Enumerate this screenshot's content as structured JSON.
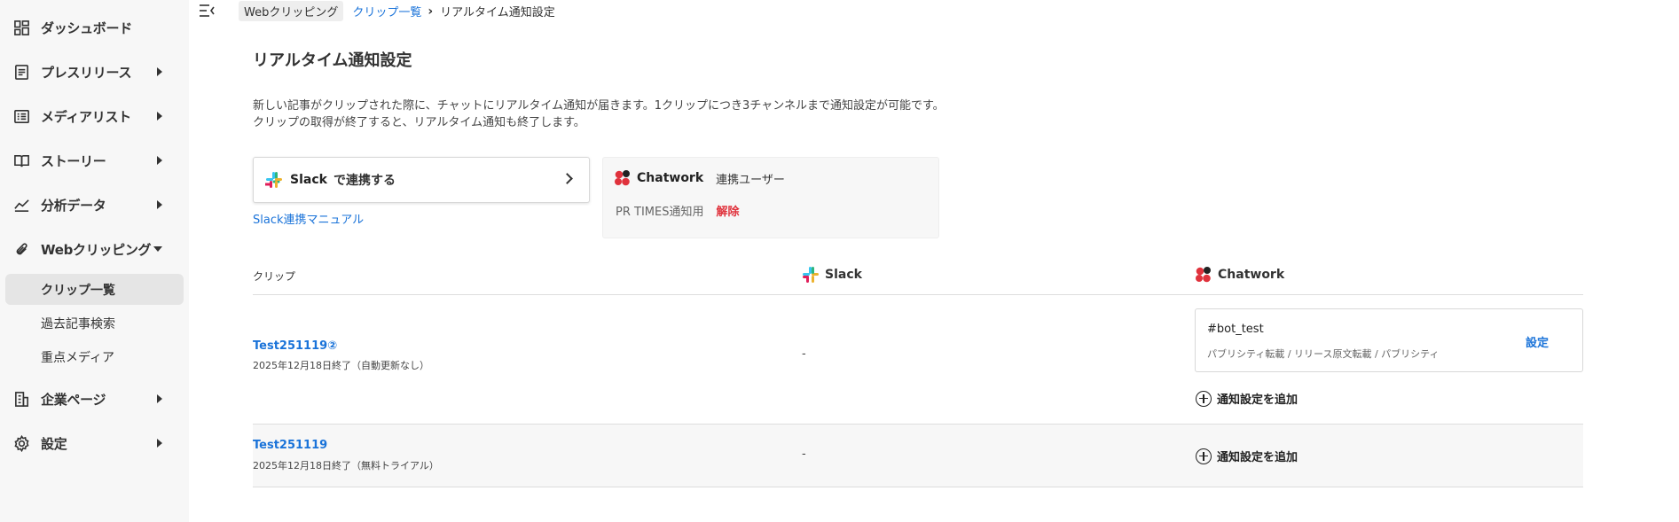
{
  "colors": {
    "accent": "#1a73d9",
    "danger": "#e0323c",
    "sidebar_bg": "#f7f7f7"
  },
  "sidebar": {
    "items": [
      {
        "label": "ダッシュボード",
        "icon": "dashboard-icon"
      },
      {
        "label": "プレスリリース",
        "icon": "document-icon"
      },
      {
        "label": "メディアリスト",
        "icon": "list-icon"
      },
      {
        "label": "ストーリー",
        "icon": "book-icon"
      },
      {
        "label": "分析データ",
        "icon": "chart-icon"
      },
      {
        "label": "Webクリッピング",
        "icon": "paperclip-icon"
      },
      {
        "label": "企業ページ",
        "icon": "building-icon"
      },
      {
        "label": "設定",
        "icon": "gear-icon"
      }
    ],
    "sub_items": [
      "クリップ一覧",
      "過去記事検索",
      "重点メディア"
    ]
  },
  "breadcrumb": {
    "root": "Webクリッピング",
    "parent": "クリップ一覧",
    "current": "リアルタイム通知設定"
  },
  "page": {
    "title": "リアルタイム通知設定",
    "desc_line1": "新しい記事がクリップされた際に、チャットにリアルタイム通知が届きます。1クリップにつき3チャンネルまで通知設定が可能です。",
    "desc_line2": "クリップの取得が終了すると、リアルタイム通知も終了します。"
  },
  "slack_card": {
    "brand": "Slack",
    "text": "で連携する",
    "manual_link": "Slack連携マニュアル"
  },
  "chatwork_card": {
    "brand": "Chatwork",
    "role": "連携ユーザー",
    "account": "PR TIMES通知用",
    "unlink": "解除"
  },
  "table": {
    "headers": {
      "clip": "クリップ",
      "slack": "Slack",
      "chatwork": "Chatwork"
    },
    "rows": [
      {
        "name": "Test251119②",
        "status": "2025年12月18日終了（自動更新なし）",
        "slack": "-",
        "chatwork_setting": {
          "channel": "#bot_test",
          "types": "パブリシティ転載 / リリース原文転載 / パブリシティ",
          "edit": "設定"
        },
        "add_label": "通知設定を追加"
      },
      {
        "name": "Test251119",
        "status": "2025年12月18日終了（無料トライアル）",
        "slack": "-",
        "add_label": "通知設定を追加"
      }
    ]
  }
}
